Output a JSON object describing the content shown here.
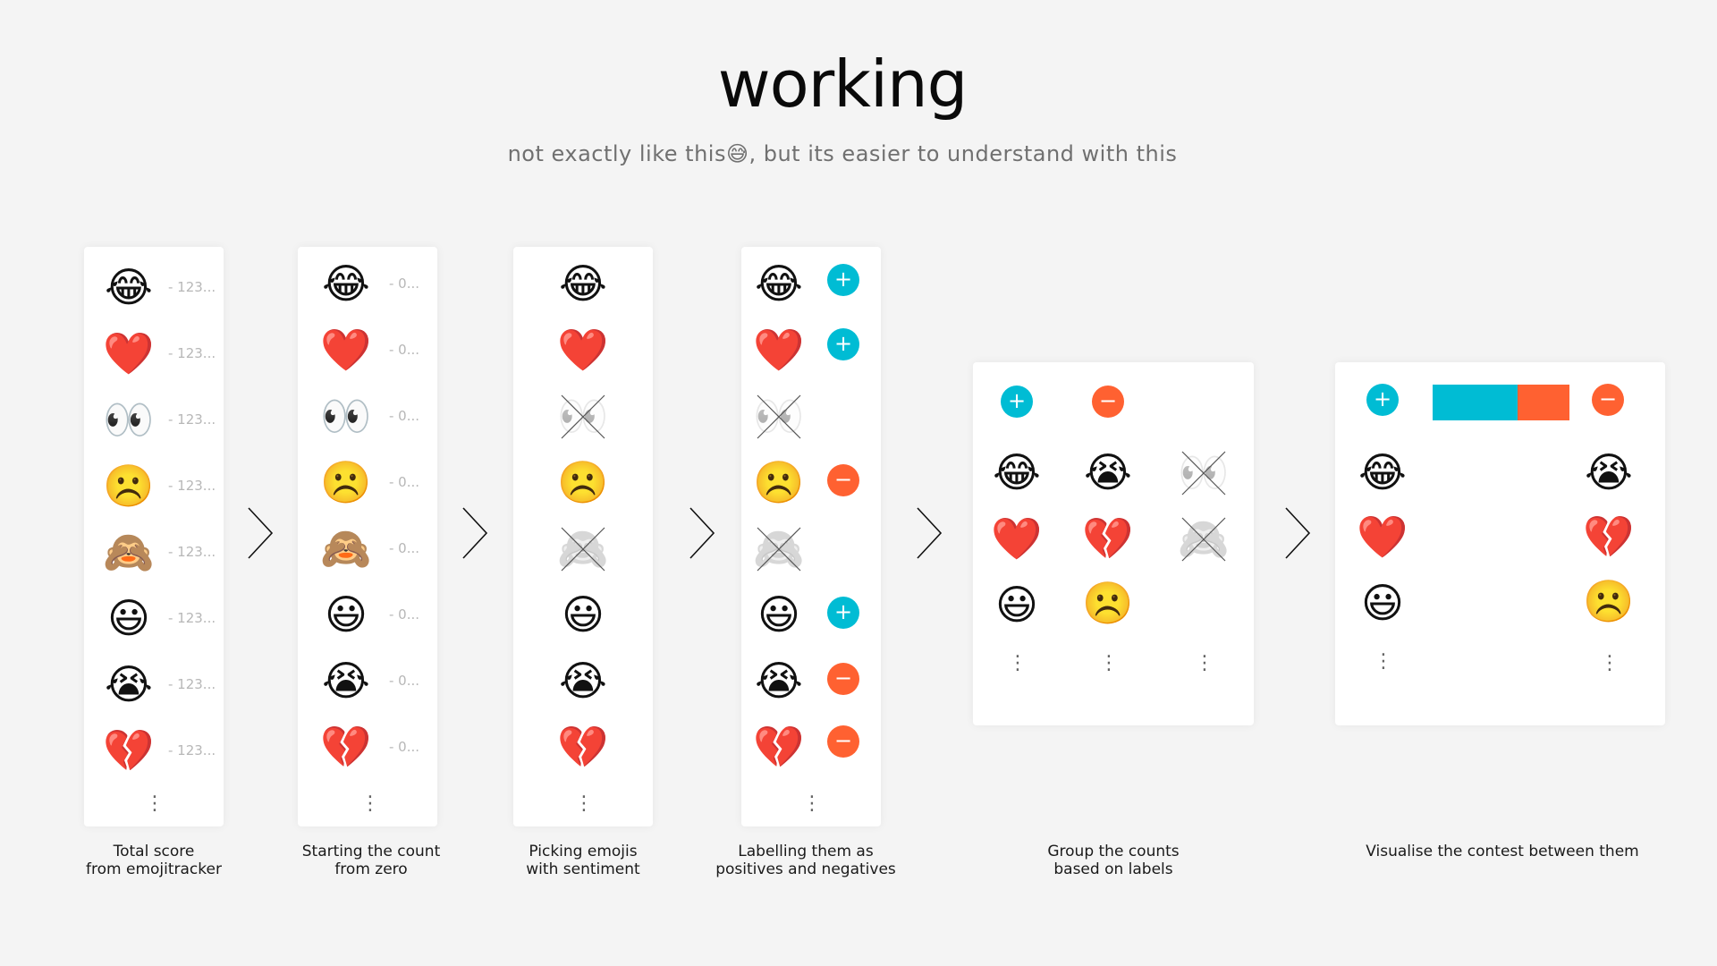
{
  "title": "working",
  "subtitle": "not exactly like this😅, but its easier to understand with this",
  "emojis": {
    "joy": "😂",
    "heart": "❤️",
    "eyes": "👀",
    "frown": "☹️",
    "monkey": "🙈",
    "smiley": "😃",
    "sob": "😭",
    "broken_heart": "💔"
  },
  "steps": [
    {
      "caption": "Total score\nfrom emojitracker",
      "count_label": "- 123..."
    },
    {
      "caption": "Starting the count\nfrom zero",
      "count_label": "- 0..."
    },
    {
      "caption": "Picking emojis\nwith sentiment"
    },
    {
      "caption": "Labelling them as\npositives and negatives"
    },
    {
      "caption": "Group the counts\nbased on labels"
    },
    {
      "caption": "Visualise the contest between them"
    }
  ],
  "badges": {
    "positive": "+",
    "negative": "−"
  },
  "more_indicator": "⋮",
  "contest": {
    "positive_share": 0.62
  },
  "colors": {
    "positive": "#00bcd4",
    "negative": "#ff6131",
    "background": "#f4f4f4"
  }
}
